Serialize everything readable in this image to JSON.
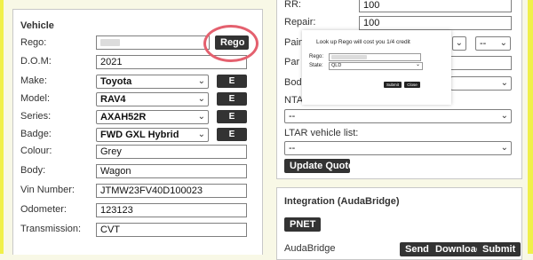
{
  "vehicle": {
    "title": "Vehicle",
    "rows": [
      {
        "label": "Rego:",
        "value": ""
      },
      {
        "label": "D.O.M:",
        "value": "2021"
      },
      {
        "label": "Make:",
        "value": "Toyota"
      },
      {
        "label": "Model:",
        "value": "RAV4"
      },
      {
        "label": "Series:",
        "value": "AXAH52R"
      },
      {
        "label": "Badge:",
        "value": "FWD GXL Hybrid"
      },
      {
        "label": "Colour:",
        "value": "Grey"
      },
      {
        "label": "Body:",
        "value": "Wagon"
      },
      {
        "label": "Vin Number:",
        "value": "JTMW23FV40D100023"
      },
      {
        "label": "Odometer:",
        "value": "123123"
      },
      {
        "label": "Transmission:",
        "value": "CVT"
      }
    ],
    "rego_button": "Rego",
    "edit_label": "E"
  },
  "quote": {
    "rr_label": "RR:",
    "rr_value": "100",
    "repair_label": "Repair:",
    "repair_value": "100",
    "paint_label": "Pain",
    "paint_select_value": "--",
    "part_label": "Par",
    "body_label": "Bod",
    "ntar_label": "NTA",
    "ntar_value": "--",
    "ltar_label": "LTAR vehicle list:",
    "ltar_value": "--",
    "update_button": "Update Quote"
  },
  "integration": {
    "title": "Integration (AudaBridge)",
    "pnet_button": "PNET",
    "audabridge_label": "AudaBridge",
    "send_button": "Send",
    "download_button": "Download",
    "submit_button": "Submit"
  },
  "modal": {
    "title": "Look up Rego will cost you 1/4 credit",
    "rego_label": "Rego:",
    "state_label": "State:",
    "state_value": "QLD",
    "submit_label": "Submit",
    "close_label": "Close"
  },
  "colors": {
    "highlight_circle": "#e4606e",
    "dark_button": "#333333",
    "side_bar": "#f0f04a"
  }
}
